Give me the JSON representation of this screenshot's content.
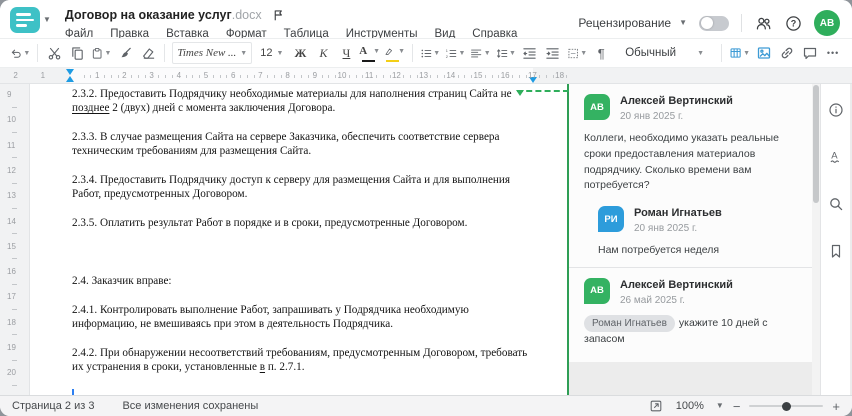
{
  "header": {
    "title": "Договор на оказание услуг",
    "title_ext": ".docx",
    "menu": [
      {
        "key": "file",
        "label": "Файл"
      },
      {
        "key": "edit",
        "label": "Правка"
      },
      {
        "key": "insert",
        "label": "Вставка"
      },
      {
        "key": "format",
        "label": "Формат"
      },
      {
        "key": "table",
        "label": "Таблица"
      },
      {
        "key": "tools",
        "label": "Инструменты"
      },
      {
        "key": "view",
        "label": "Вид"
      },
      {
        "key": "help",
        "label": "Справка"
      }
    ],
    "review_label": "Рецензирование",
    "user_initials": "АВ",
    "user_color": "#2fae5c"
  },
  "toolbar": {
    "font_name": "Times New ...",
    "font_size": "12",
    "bold_label": "Ж",
    "italic_label": "К",
    "underline_label": "Ч",
    "font_color_letter": "А",
    "pilcrow": "¶",
    "style_name": "Обычный",
    "more_label": "•••",
    "accent_blue": "#3d9bd5",
    "highlight_yellow": "#f3cf17"
  },
  "ruler": {
    "h_pre": [
      "2",
      "1"
    ],
    "h_numbers": [
      "1",
      "2",
      "3",
      "4",
      "5",
      "6",
      "7",
      "8",
      "9",
      "10",
      "11",
      "12",
      "13",
      "14",
      "15",
      "16",
      "17",
      "18"
    ],
    "v_numbers": [
      "9",
      "10",
      "11",
      "12",
      "13",
      "14",
      "15",
      "16",
      "17",
      "18",
      "19",
      "20"
    ]
  },
  "document": {
    "paragraphs": [
      {
        "segments": [
          {
            "t": "2.3.2. Предоставить Подрядчику необходимые материалы для наполнения страниц Сайта не "
          },
          {
            "t": "позднее",
            "u": true
          },
          {
            "t": " 2 (двух) дней с момента заключения Договора."
          }
        ]
      },
      {
        "segments": [
          {
            "t": "2.3.3. В случае размещения Сайта на сервере Заказчика, обеспечить соответствие сервера техническим требованиям для размещения Сайта."
          }
        ]
      },
      {
        "segments": [
          {
            "t": "2.3.4. Предоставить Подрядчику доступ к серверу для размещения Сайта и для выполнения Работ, предусмотренных Договором."
          }
        ]
      },
      {
        "segments": [
          {
            "t": "2.3.5. Оплатить результат Работ в порядке и в сроки, предусмотренные Договором."
          }
        ]
      },
      {
        "blank": true
      },
      {
        "segments": [
          {
            "t": "2.4. Заказчик вправе:"
          }
        ]
      },
      {
        "segments": [
          {
            "t": "2.4.1. Контролировать выполнение Работ, запрашивать у Подрядчика необходимую информацию, не вмешиваясь при этом в деятельность Подрядчика."
          }
        ]
      },
      {
        "segments": [
          {
            "t": "2.4.2. При обнаружении несоответствий требованиям, предусмотренным Договором, требовать их устранения в сроки, установленные "
          },
          {
            "t": "в",
            "u": true
          },
          {
            "t": " п. 2.7.1."
          }
        ]
      }
    ]
  },
  "comments": {
    "accent_green": "#2f9e55",
    "threads": [
      {
        "author": "Алексей Вертинский",
        "initials": "АВ",
        "color": "#34b262",
        "date": "20 янв 2025 г.",
        "text": "Коллеги, необходимо указать реальные сроки предоставления материалов подрядчику. Сколько времени вам потребуется?",
        "replies": [
          {
            "author": "Роман Игнатьев",
            "initials": "РИ",
            "color": "#2d9cdb",
            "date": "20 янв 2025 г.",
            "text": "Нам потребуется неделя"
          }
        ]
      },
      {
        "author": "Алексей Вертинский",
        "initials": "АВ",
        "color": "#34b262",
        "date": "26 май 2025 г.",
        "mention": "Роман Игнатьев",
        "text": "укажите 10 дней с запасом",
        "replies": []
      }
    ]
  },
  "status_bar": {
    "page_info": "Страница 2 из 3",
    "save_status": "Все изменения сохранены",
    "zoom_value": "100%"
  }
}
